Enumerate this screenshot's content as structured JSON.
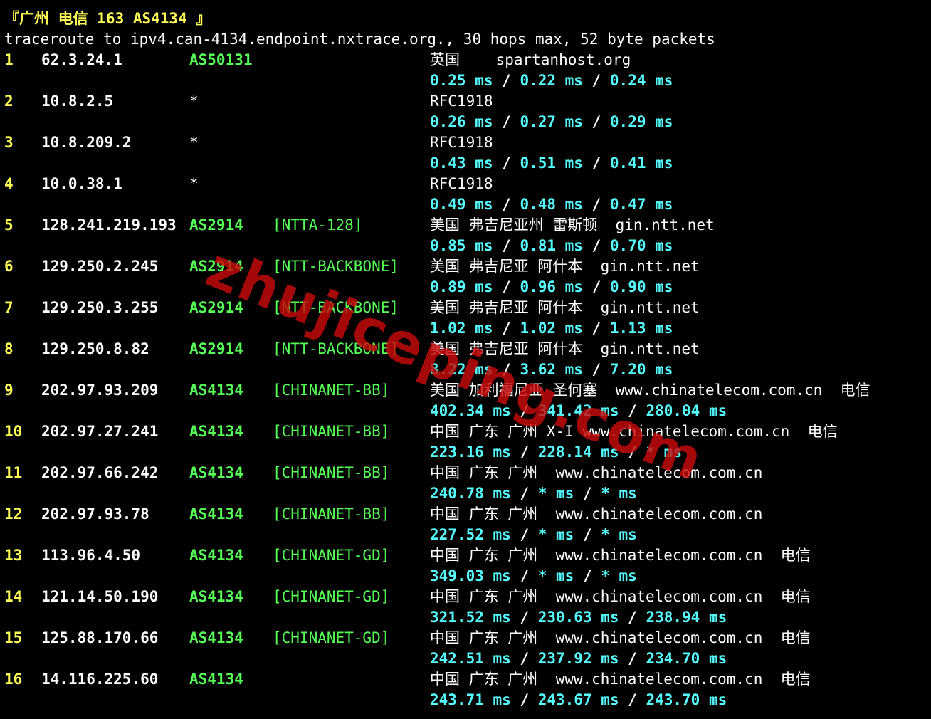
{
  "header": {
    "title": "『广州 电信 163 AS4134 』",
    "command": "traceroute to ipv4.can-4134.endpoint.nxtrace.org., 30 hops max, 52 byte packets"
  },
  "watermark": "zhujiceping.com",
  "colors": {
    "background": "#000000",
    "hop_number": "#ffff55",
    "asn": "#55ff55",
    "latency": "#55ffff",
    "text": "#ffffff"
  },
  "hops": [
    {
      "no": "1",
      "ip": "62.3.24.1",
      "asn": "AS50131",
      "net": "",
      "geo": "英国    spartanhost.org",
      "lat1": "0.25 ms",
      "lat2": "0.22 ms",
      "lat3": "0.24 ms"
    },
    {
      "no": "2",
      "ip": "10.8.2.5",
      "asn": "*",
      "net": "",
      "geo": "RFC1918",
      "lat1": "0.26 ms",
      "lat2": "0.27 ms",
      "lat3": "0.29 ms"
    },
    {
      "no": "3",
      "ip": "10.8.209.2",
      "asn": "*",
      "net": "",
      "geo": "RFC1918",
      "lat1": "0.43 ms",
      "lat2": "0.51 ms",
      "lat3": "0.41 ms"
    },
    {
      "no": "4",
      "ip": "10.0.38.1",
      "asn": "*",
      "net": "",
      "geo": "RFC1918",
      "lat1": "0.49 ms",
      "lat2": "0.48 ms",
      "lat3": "0.47 ms"
    },
    {
      "no": "5",
      "ip": "128.241.219.193",
      "asn": "AS2914",
      "net": "[NTTA-128]",
      "geo": "美国 弗吉尼亚州 雷斯顿  gin.ntt.net",
      "lat1": "0.85 ms",
      "lat2": "0.81 ms",
      "lat3": "0.70 ms"
    },
    {
      "no": "6",
      "ip": "129.250.2.245",
      "asn": "AS2914",
      "net": "[NTT-BACKBONE]",
      "geo": "美国 弗吉尼亚 阿什本  gin.ntt.net",
      "lat1": "0.89 ms",
      "lat2": "0.96 ms",
      "lat3": "0.90 ms"
    },
    {
      "no": "7",
      "ip": "129.250.3.255",
      "asn": "AS2914",
      "net": "[NTT-BACKBONE]",
      "geo": "美国 弗吉尼亚 阿什本  gin.ntt.net",
      "lat1": "1.02 ms",
      "lat2": "1.02 ms",
      "lat3": "1.13 ms"
    },
    {
      "no": "8",
      "ip": "129.250.8.82",
      "asn": "AS2914",
      "net": "[NTT-BACKBONE]",
      "geo": "美国 弗吉尼亚 阿什本  gin.ntt.net",
      "lat1": "8.22 ms",
      "lat2": "3.62 ms",
      "lat3": "7.20 ms"
    },
    {
      "no": "9",
      "ip": "202.97.93.209",
      "asn": "AS4134",
      "net": "[CHINANET-BB]",
      "geo": "美国 加利福尼亚 圣何塞  www.chinatelecom.com.cn  电信",
      "lat1": "402.34 ms",
      "lat2": "341.42 ms",
      "lat3": "280.04 ms"
    },
    {
      "no": "10",
      "ip": "202.97.27.241",
      "asn": "AS4134",
      "net": "[CHINANET-BB]",
      "geo": "中国 广东 广州 X-I www.chinatelecom.com.cn  电信",
      "lat1": "223.16 ms",
      "lat2": "228.14 ms",
      "lat3": "* ms"
    },
    {
      "no": "11",
      "ip": "202.97.66.242",
      "asn": "AS4134",
      "net": "[CHINANET-BB]",
      "geo": "中国 广东 广州  www.chinatelecom.com.cn",
      "lat1": "240.78 ms",
      "lat2": "* ms",
      "lat3": "* ms"
    },
    {
      "no": "12",
      "ip": "202.97.93.78",
      "asn": "AS4134",
      "net": "[CHINANET-BB]",
      "geo": "中国 广东 广州  www.chinatelecom.com.cn",
      "lat1": "227.52 ms",
      "lat2": "* ms",
      "lat3": "* ms"
    },
    {
      "no": "13",
      "ip": "113.96.4.50",
      "asn": "AS4134",
      "net": "[CHINANET-GD]",
      "geo": "中国 广东 广州  www.chinatelecom.com.cn  电信",
      "lat1": "349.03 ms",
      "lat2": "* ms",
      "lat3": "* ms"
    },
    {
      "no": "14",
      "ip": "121.14.50.190",
      "asn": "AS4134",
      "net": "[CHINANET-GD]",
      "geo": "中国 广东 广州  www.chinatelecom.com.cn  电信",
      "lat1": "321.52 ms",
      "lat2": "230.63 ms",
      "lat3": "238.94 ms"
    },
    {
      "no": "15",
      "ip": "125.88.170.66",
      "asn": "AS4134",
      "net": "[CHINANET-GD]",
      "geo": "中国 广东 广州  www.chinatelecom.com.cn  电信",
      "lat1": "242.51 ms",
      "lat2": "237.92 ms",
      "lat3": "234.70 ms"
    },
    {
      "no": "16",
      "ip": "14.116.225.60",
      "asn": "AS4134",
      "net": "",
      "geo": "中国 广东 广州  www.chinatelecom.com.cn  电信",
      "lat1": "243.71 ms",
      "lat2": "243.67 ms",
      "lat3": "243.70 ms"
    }
  ]
}
